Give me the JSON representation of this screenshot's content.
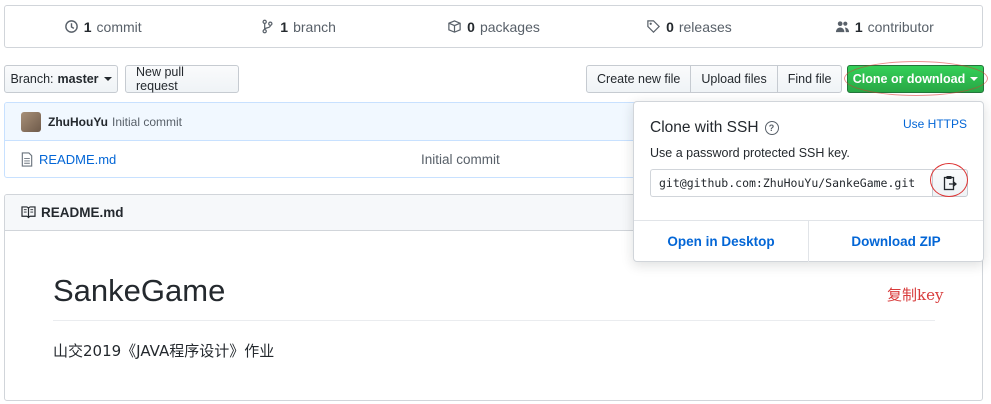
{
  "summary": {
    "commits": {
      "count": "1",
      "label": "commit",
      "icon": "history-icon"
    },
    "branches": {
      "count": "1",
      "label": "branch",
      "icon": "git-branch-icon"
    },
    "packages": {
      "count": "0",
      "label": "packages",
      "icon": "package-icon"
    },
    "releases": {
      "count": "0",
      "label": "releases",
      "icon": "tag-icon"
    },
    "contributors": {
      "count": "1",
      "label": "contributor",
      "icon": "people-icon"
    }
  },
  "toolbar": {
    "branch_prefix": "Branch:",
    "branch_name": "master",
    "new_pr": "New pull request",
    "create_file": "Create new file",
    "upload_files": "Upload files",
    "find_file": "Find file",
    "clone": "Clone or download"
  },
  "commit": {
    "author": "ZhuHouYu",
    "message": "Initial commit"
  },
  "files": [
    {
      "name": "README.md",
      "message": "Initial commit",
      "icon": "file-icon"
    }
  ],
  "readme": {
    "header": "README.md",
    "title": "SankeGame",
    "description": "山交2019《JAVA程序设计》作业"
  },
  "clone_popover": {
    "title": "Clone with SSH",
    "help": "?",
    "switch": "Use HTTPS",
    "subtitle": "Use a password protected SSH key.",
    "url": "git@github.com:ZhuHouYu/SankeGame.git",
    "open_desktop": "Open in Desktop",
    "download_zip": "Download ZIP"
  },
  "annotation": "复制key",
  "colors": {
    "accent": "#0366d6",
    "green": "#28a745",
    "annotation": "#d83b3b"
  }
}
